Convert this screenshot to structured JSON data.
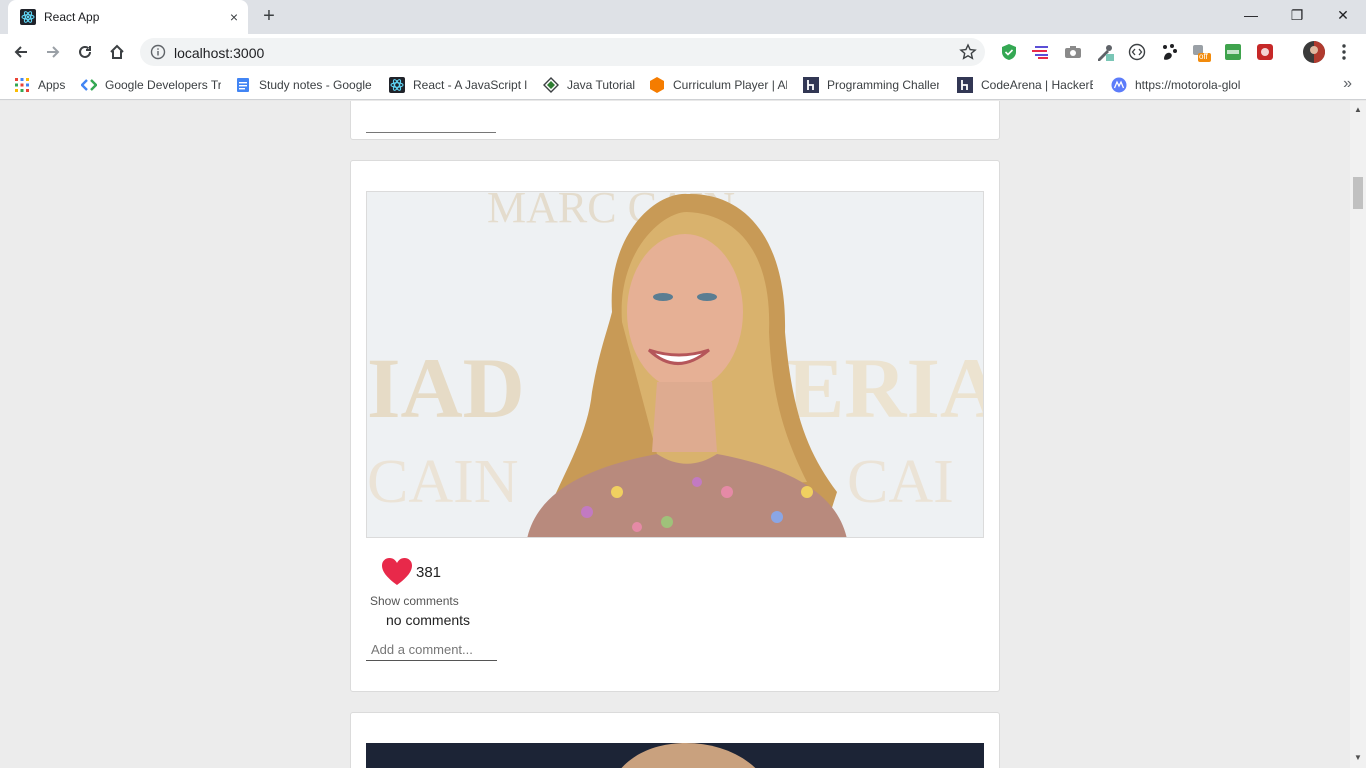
{
  "browser": {
    "tab_title": "React App",
    "tab_close": "×",
    "new_tab": "+",
    "window_minimize": "—",
    "window_restore": "❐",
    "window_close": "✕",
    "url": "localhost:3000",
    "bookmarks": [
      {
        "label": "Apps",
        "icon": "apps-grid-icon"
      },
      {
        "label": "Google Developers Tr",
        "icon": "google-developers-icon"
      },
      {
        "label": "Study notes - Google",
        "icon": "google-docs-icon"
      },
      {
        "label": "React - A JavaScript li",
        "icon": "react-icon"
      },
      {
        "label": "Java Tutorial",
        "icon": "java-tutorial-icon"
      },
      {
        "label": "Curriculum Player | Al",
        "icon": "curriculum-player-icon"
      },
      {
        "label": "Programming Challen",
        "icon": "hackerearth-icon"
      },
      {
        "label": "CodeArena | HackerE",
        "icon": "hackerearth-icon"
      },
      {
        "label": "https://motorola-glol",
        "icon": "motorola-icon"
      }
    ],
    "bookmarks_more": "»",
    "extension_badge": "off"
  },
  "post": {
    "like_count": "381",
    "show_comments_label": "Show comments",
    "no_comments_label": "no comments",
    "comment_placeholder": "Add a comment..."
  },
  "colors": {
    "heart": "#e8294a",
    "card_background": "#ffffff",
    "page_background": "#ececec"
  }
}
